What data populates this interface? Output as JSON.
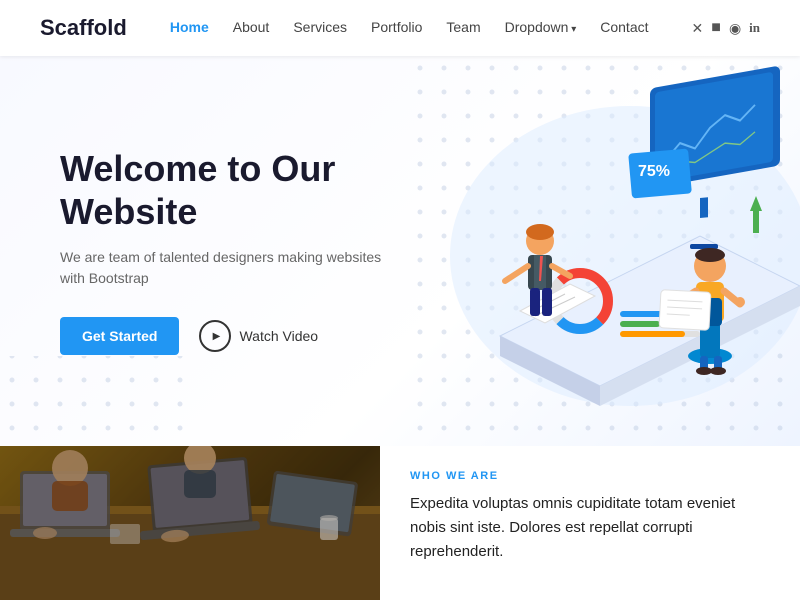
{
  "brand": "Scaffold",
  "nav": {
    "links": [
      {
        "label": "Home",
        "active": true,
        "dropdown": false
      },
      {
        "label": "About",
        "active": false,
        "dropdown": false
      },
      {
        "label": "Services",
        "active": false,
        "dropdown": false
      },
      {
        "label": "Portfolio",
        "active": false,
        "dropdown": false
      },
      {
        "label": "Team",
        "active": false,
        "dropdown": false
      },
      {
        "label": "Dropdown",
        "active": false,
        "dropdown": true
      },
      {
        "label": "Contact",
        "active": false,
        "dropdown": false
      }
    ],
    "social": [
      "✕",
      "f",
      "◉",
      "in"
    ]
  },
  "hero": {
    "title": "Welcome to Our Website",
    "subtitle": "We are team of talented designers making websites with Bootstrap",
    "cta_primary": "Get Started",
    "cta_video": "Watch Video"
  },
  "bottom": {
    "label": "WHO WE ARE",
    "text": "Expedita voluptas omnis cupiditate totam eveniet nobis sint iste. Dolores est repellat corrupti reprehenderit."
  }
}
